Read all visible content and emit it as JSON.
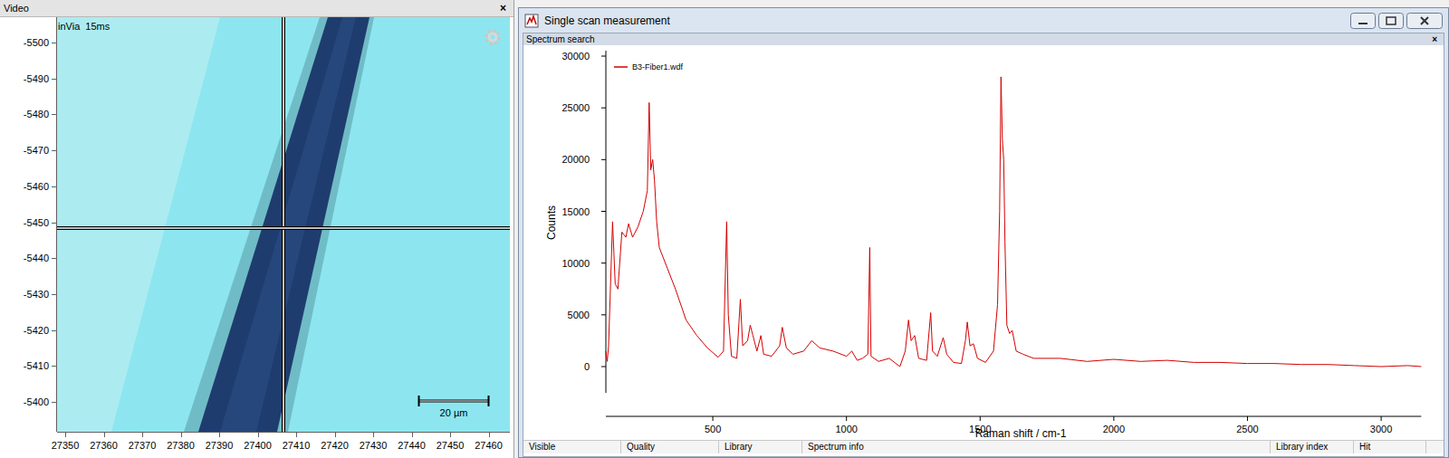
{
  "video": {
    "title": "Video",
    "close": "×",
    "overlay": "inVia  15ms",
    "scale_bar": "20 µm",
    "y_ticks": [
      "-5500",
      "-5490",
      "-5480",
      "-5470",
      "-5460",
      "-5450",
      "-5440",
      "-5430",
      "-5420",
      "-5410",
      "-5400"
    ],
    "x_ticks": [
      "27350",
      "27360",
      "27370",
      "27380",
      "27390",
      "27400",
      "27410",
      "27420",
      "27430",
      "27440",
      "27450",
      "27460"
    ]
  },
  "measurement": {
    "title": "Single scan measurement",
    "panel": "Spectrum search",
    "panel_close": "×",
    "chart": {
      "legend": "B3-Fiber1.wdf",
      "y_label": "Counts",
      "x_label": "Raman shift / cm-1",
      "y_ticks": [
        "0",
        "5000",
        "10000",
        "15000",
        "20000",
        "25000",
        "30000"
      ],
      "x_ticks": [
        "500",
        "1000",
        "1500",
        "2000",
        "2500",
        "3000"
      ],
      "shift": [
        100,
        105,
        110,
        125,
        135,
        145,
        160,
        175,
        185,
        200,
        220,
        240,
        255,
        262,
        268,
        275,
        282,
        290,
        300,
        330,
        360,
        400,
        440,
        480,
        520,
        540,
        552,
        558,
        570,
        590,
        603,
        612,
        630,
        640,
        650,
        665,
        680,
        690,
        720,
        750,
        760,
        775,
        800,
        840,
        870,
        900,
        950,
        1000,
        1020,
        1040,
        1060,
        1080,
        1087,
        1092,
        1120,
        1160,
        1200,
        1220,
        1232,
        1242,
        1255,
        1270,
        1300,
        1315,
        1322,
        1340,
        1362,
        1375,
        1400,
        1430,
        1445,
        1452,
        1462,
        1475,
        1490,
        1520,
        1550,
        1565,
        1573,
        1578,
        1583,
        1588,
        1593,
        1600,
        1610,
        1620,
        1635,
        1660,
        1700,
        1800,
        1900,
        2000,
        2100,
        2200,
        2300,
        2400,
        2500,
        2600,
        2700,
        2800,
        2900,
        3000,
        3100,
        3150
      ],
      "counts": [
        1500,
        500,
        2000,
        14000,
        8000,
        7500,
        13000,
        12500,
        13800,
        12500,
        13500,
        15000,
        17000,
        25500,
        19000,
        20000,
        18000,
        14000,
        11500,
        9500,
        7500,
        4500,
        3000,
        1800,
        900,
        1500,
        14000,
        5000,
        1000,
        800,
        6500,
        2000,
        2500,
        4000,
        3000,
        1500,
        3000,
        1200,
        1000,
        2000,
        3800,
        1800,
        1200,
        1500,
        2500,
        1800,
        1500,
        1000,
        1500,
        600,
        800,
        1200,
        11500,
        1000,
        500,
        800,
        0,
        1500,
        4500,
        2500,
        3000,
        800,
        600,
        5200,
        1500,
        1000,
        2800,
        1200,
        400,
        300,
        2500,
        4300,
        2000,
        2200,
        800,
        400,
        1500,
        6000,
        15000,
        28000,
        22000,
        20000,
        12000,
        4000,
        3200,
        3500,
        1500,
        1200,
        800,
        800,
        500,
        700,
        500,
        600,
        400,
        400,
        300,
        300,
        200,
        200,
        100,
        0,
        100,
        0
      ]
    },
    "columns": [
      "Visible",
      "Quality",
      "Library",
      "Spectrum info",
      "Library index",
      "Hit"
    ]
  }
}
